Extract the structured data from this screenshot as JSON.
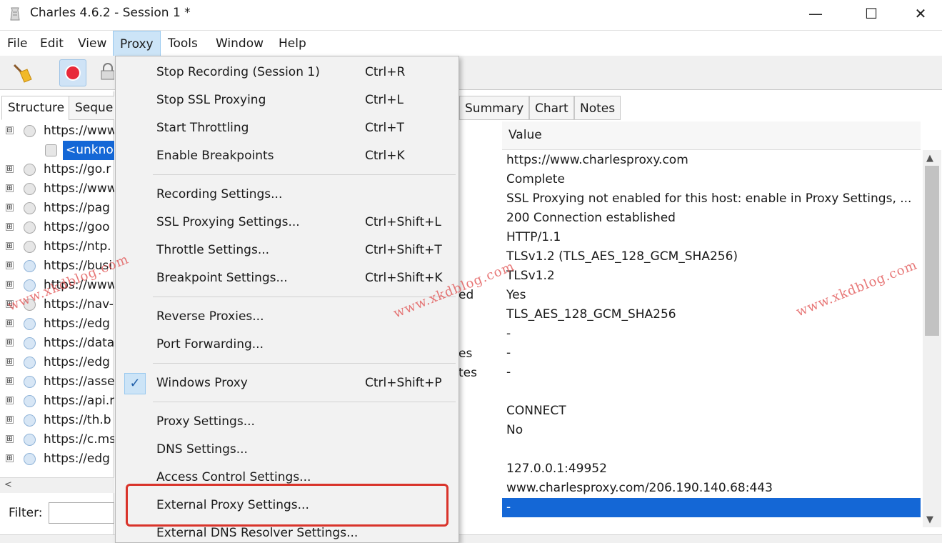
{
  "window": {
    "title": "Charles 4.6.2 - Session 1 *",
    "minimize": "—",
    "maximize": "☐",
    "close": "✕"
  },
  "menubar": {
    "items": [
      {
        "label": "File"
      },
      {
        "label": "Edit"
      },
      {
        "label": "View"
      },
      {
        "label": "Proxy"
      },
      {
        "label": "Tools"
      },
      {
        "label": "Window"
      },
      {
        "label": "Help"
      }
    ]
  },
  "left_tabs": [
    "Structure",
    "Seque"
  ],
  "tree": [
    {
      "text": "https://www",
      "expander": "⊟",
      "icon": "globe-icon"
    },
    {
      "text": "<unkno",
      "expander": "",
      "icon": "lock-icon"
    },
    {
      "text": "https://go.r",
      "expander": "⊞",
      "icon": "globe-icon"
    },
    {
      "text": "https://www",
      "expander": "⊞",
      "icon": "globe-icon"
    },
    {
      "text": "https://pag",
      "expander": "⊞",
      "icon": "globe-icon"
    },
    {
      "text": "https://goo",
      "expander": "⊞",
      "icon": "globe-icon"
    },
    {
      "text": "https://ntp.",
      "expander": "⊞",
      "icon": "globe-icon"
    },
    {
      "text": "https://busi",
      "expander": "⊞",
      "icon": "globe-icon"
    },
    {
      "text": "https://www",
      "expander": "⊞",
      "icon": "globe-icon"
    },
    {
      "text": "https://nav-",
      "expander": "⊞",
      "icon": "globe-icon"
    },
    {
      "text": "https://edg",
      "expander": "⊞",
      "icon": "globe-icon"
    },
    {
      "text": "https://data",
      "expander": "⊞",
      "icon": "globe-icon"
    },
    {
      "text": "https://edg",
      "expander": "⊞",
      "icon": "globe-icon"
    },
    {
      "text": "https://asse",
      "expander": "⊞",
      "icon": "globe-icon"
    },
    {
      "text": "https://api.r",
      "expander": "⊞",
      "icon": "globe-icon"
    },
    {
      "text": "https://th.b",
      "expander": "⊞",
      "icon": "globe-icon"
    },
    {
      "text": "https://c.ms",
      "expander": "⊞",
      "icon": "globe-icon"
    },
    {
      "text": "https://edg",
      "expander": "⊞",
      "icon": "globe-icon"
    }
  ],
  "filter": {
    "label": "Filter:",
    "value": ""
  },
  "right_tabs": [
    "Summary",
    "Chart",
    "Notes"
  ],
  "overview": {
    "value_header": "Value",
    "key_fragments": [
      "ed",
      "es",
      "tes"
    ],
    "values": [
      "https://www.charlesproxy.com",
      "Complete",
      "SSL Proxying not enabled for this host: enable in Proxy Settings, ...",
      "200 Connection established",
      "HTTP/1.1",
      "TLSv1.2 (TLS_AES_128_GCM_SHA256)",
      "TLSv1.2",
      "Yes",
      "TLS_AES_128_GCM_SHA256",
      "-",
      "-",
      "-",
      "",
      "CONNECT",
      "No",
      "",
      "127.0.0.1:49952",
      "www.charlesproxy.com/206.190.140.68:443",
      "-"
    ]
  },
  "proxy_menu": {
    "items": [
      {
        "label": "Stop Recording (Session 1)",
        "shortcut": "Ctrl+R"
      },
      {
        "label": "Stop SSL Proxying",
        "shortcut": "Ctrl+L"
      },
      {
        "label": "Start Throttling",
        "shortcut": "Ctrl+T"
      },
      {
        "label": "Enable Breakpoints",
        "shortcut": "Ctrl+K"
      },
      {
        "label": "Recording Settings...",
        "shortcut": ""
      },
      {
        "label": "SSL Proxying Settings...",
        "shortcut": "Ctrl+Shift+L"
      },
      {
        "label": "Throttle Settings...",
        "shortcut": "Ctrl+Shift+T"
      },
      {
        "label": "Breakpoint Settings...",
        "shortcut": "Ctrl+Shift+K"
      },
      {
        "label": "Reverse Proxies...",
        "shortcut": ""
      },
      {
        "label": "Port Forwarding...",
        "shortcut": ""
      },
      {
        "label": "Windows Proxy",
        "shortcut": "Ctrl+Shift+P",
        "checked": true
      },
      {
        "label": "Proxy Settings...",
        "shortcut": ""
      },
      {
        "label": "DNS Settings...",
        "shortcut": ""
      },
      {
        "label": "Access Control Settings...",
        "shortcut": ""
      },
      {
        "label": "External Proxy Settings...",
        "shortcut": ""
      },
      {
        "label": "External DNS Resolver Settings...",
        "shortcut": ""
      }
    ],
    "check_glyph": "✓"
  },
  "watermark": "www.xkdblog.com",
  "colors": {
    "selection": "#1467d6",
    "menu_highlight": "#cce4f7",
    "annotation_box": "#d9342b",
    "record_dot": "#e8293a",
    "watermark": "#e04a4a"
  }
}
